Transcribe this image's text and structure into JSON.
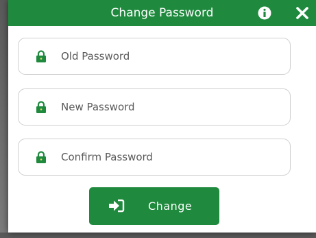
{
  "dialog": {
    "title": "Change Password",
    "colors": {
      "header": "#1f8a3e",
      "button": "#1f8a3e",
      "lock": "#1f8a3e"
    },
    "icons": {
      "info": "info-circle-icon",
      "close": "close-icon"
    }
  },
  "fields": {
    "old_password": {
      "placeholder": "Old Password",
      "value": "",
      "icon": "lock-icon"
    },
    "new_password": {
      "placeholder": "New Password",
      "value": "",
      "icon": "lock-icon"
    },
    "confirm_password": {
      "placeholder": "Confirm Password",
      "value": "",
      "icon": "lock-icon"
    }
  },
  "actions": {
    "change_label": "Change",
    "change_icon": "sign-in-icon"
  }
}
